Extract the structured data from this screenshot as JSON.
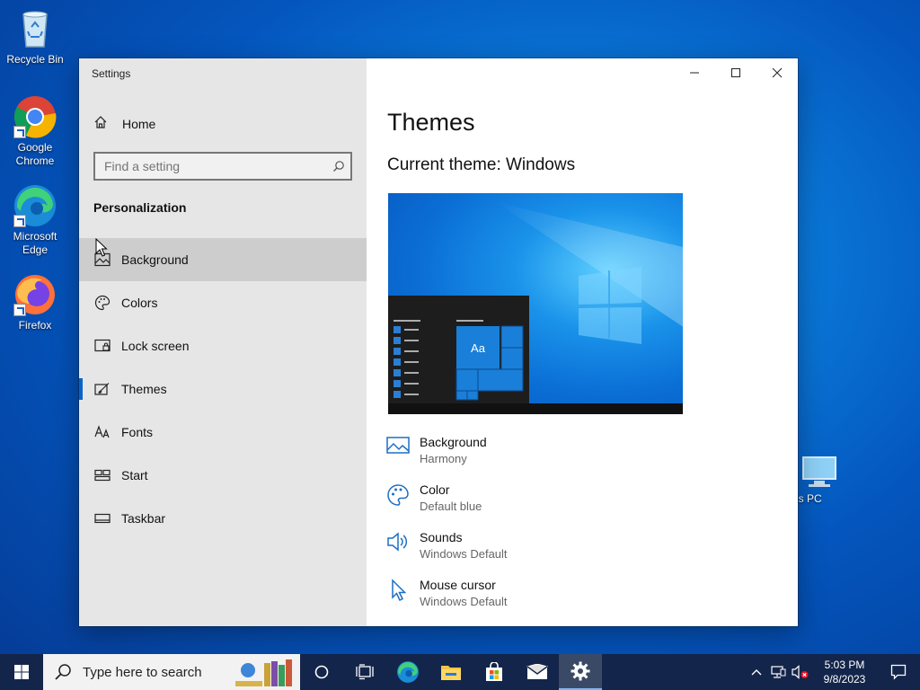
{
  "desktop": {
    "icons": [
      {
        "label": "Recycle Bin"
      },
      {
        "label": "Google Chrome"
      },
      {
        "label": "Microsoft Edge"
      },
      {
        "label": "Firefox"
      },
      {
        "label": "is PC"
      }
    ]
  },
  "window": {
    "title": "Settings",
    "home_label": "Home",
    "search_placeholder": "Find a setting",
    "section": "Personalization",
    "nav": [
      {
        "label": "Background",
        "icon": "image-icon"
      },
      {
        "label": "Colors",
        "icon": "palette-icon"
      },
      {
        "label": "Lock screen",
        "icon": "lock-screen-icon"
      },
      {
        "label": "Themes",
        "icon": "themes-icon",
        "selected": true
      },
      {
        "label": "Fonts",
        "icon": "fonts-icon"
      },
      {
        "label": "Start",
        "icon": "start-icon"
      },
      {
        "label": "Taskbar",
        "icon": "taskbar-icon"
      }
    ],
    "content": {
      "title": "Themes",
      "current_theme": "Current theme: Windows",
      "preview_sample": "Aa",
      "properties": [
        {
          "name": "Background",
          "value": "Harmony",
          "icon": "image-icon"
        },
        {
          "name": "Color",
          "value": "Default blue",
          "icon": "palette-icon"
        },
        {
          "name": "Sounds",
          "value": "Windows Default",
          "icon": "speaker-icon"
        },
        {
          "name": "Mouse cursor",
          "value": "Windows Default",
          "icon": "cursor-icon"
        }
      ]
    }
  },
  "taskbar": {
    "search_placeholder": "Type here to search",
    "time": "5:03 PM",
    "date": "9/8/2023"
  },
  "colors": {
    "accent": "#0a64c8",
    "taskbar": "#13254a"
  }
}
